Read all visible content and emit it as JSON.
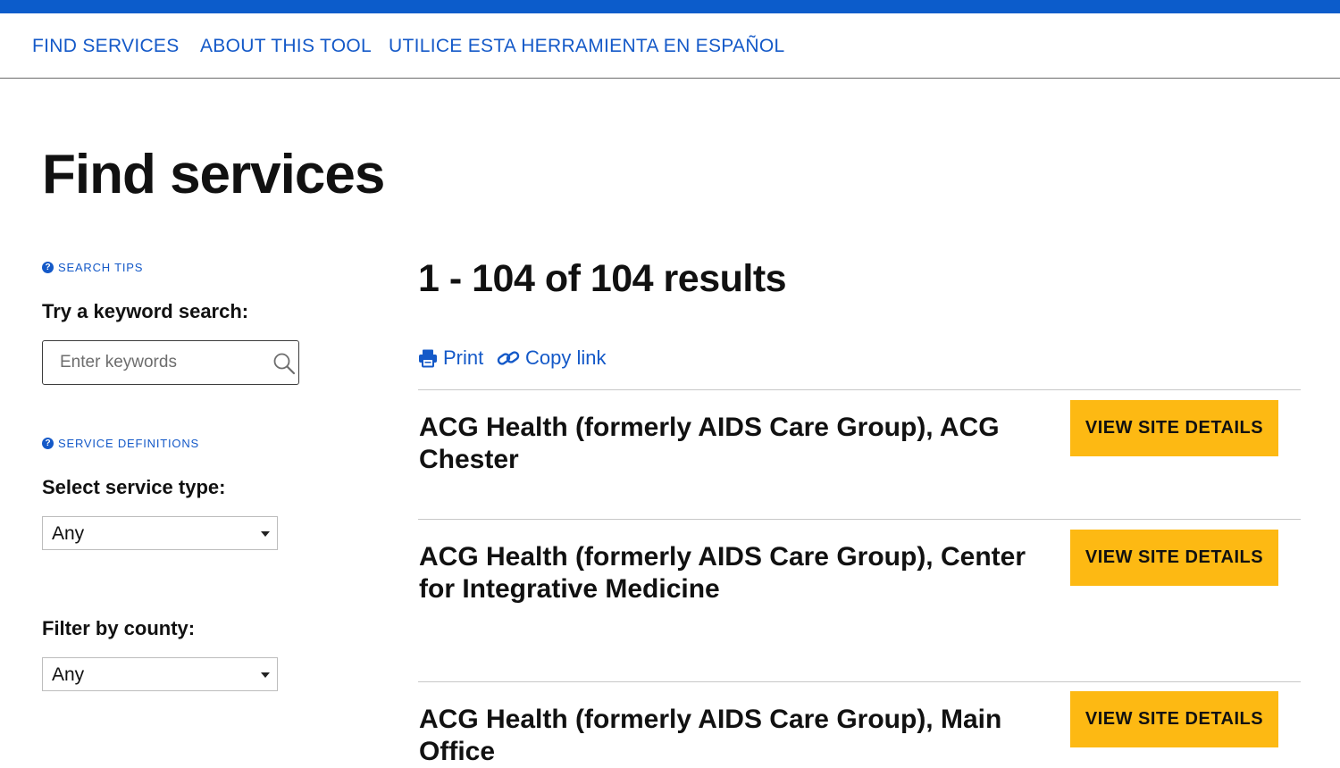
{
  "nav": {
    "items": [
      {
        "label": "FIND SERVICES"
      },
      {
        "label": "ABOUT THIS TOOL"
      },
      {
        "label": "UTILICE ESTA HERRAMIENTA EN ESPAÑOL"
      }
    ]
  },
  "page": {
    "title": "Find services"
  },
  "sidebar": {
    "search_tips": "SEARCH TIPS",
    "keyword_label": "Try a keyword search:",
    "keyword_placeholder": "Enter keywords",
    "service_definitions": "SERVICE DEFINITIONS",
    "service_type_label": "Select service type:",
    "service_type_value": "Any",
    "county_label": "Filter by county:",
    "county_value": "Any"
  },
  "results": {
    "count_text": "1 - 104 of 104 results",
    "print_label": "Print",
    "copy_link_label": "Copy link",
    "items": [
      {
        "name": "ACG Health (formerly AIDS Care Group), ACG Chester",
        "button": "VIEW SITE DETAILS"
      },
      {
        "name": "ACG Health (formerly AIDS Care Group), Center for Integrative Medicine",
        "button": "VIEW SITE DETAILS"
      },
      {
        "name": "ACG Health (formerly AIDS Care Group), Main Office",
        "button": "VIEW SITE DETAILS"
      }
    ]
  },
  "colors": {
    "brand_blue": "#0c5ccb",
    "link_blue": "#1459c8",
    "button_yellow": "#fdb913"
  }
}
